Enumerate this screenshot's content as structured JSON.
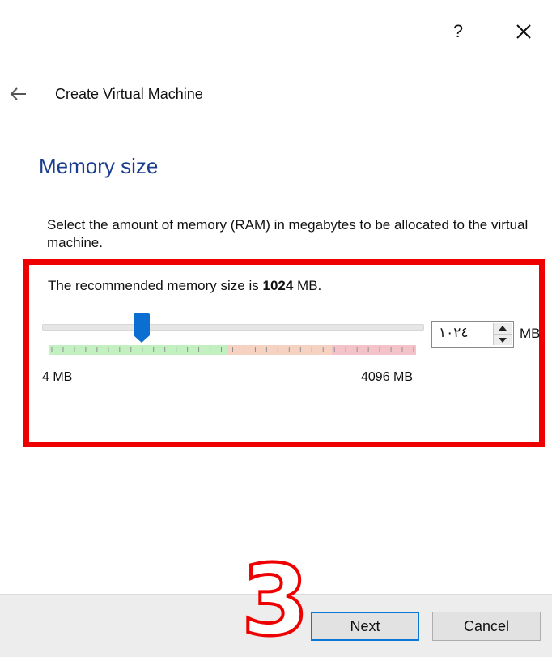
{
  "titlebar": {
    "help_label": "?",
    "close_icon": "close-icon"
  },
  "header": {
    "back_icon": "back-arrow-icon",
    "title": "Create Virtual Machine"
  },
  "page": {
    "title": "Memory size",
    "description": "Select the amount of memory (RAM) in megabytes to be allocated to the virtual machine."
  },
  "memory": {
    "recommendation_prefix": "The recommended memory size is ",
    "recommended_value": "1024",
    "recommendation_suffix": " MB.",
    "slider_value_mb": 1024,
    "slider_min_label": "4 MB",
    "slider_max_label": "4096 MB",
    "spinbox_value": "١٠٢٤",
    "unit_label": "MB"
  },
  "annotation": {
    "step_number": "3",
    "highlight_color": "#ee0000"
  },
  "footer": {
    "next_label": "Next",
    "cancel_label": "Cancel"
  },
  "colors": {
    "title_blue": "#1a3d8f",
    "focus_blue": "#0a78d7",
    "handle_blue": "#0a6fd0"
  }
}
